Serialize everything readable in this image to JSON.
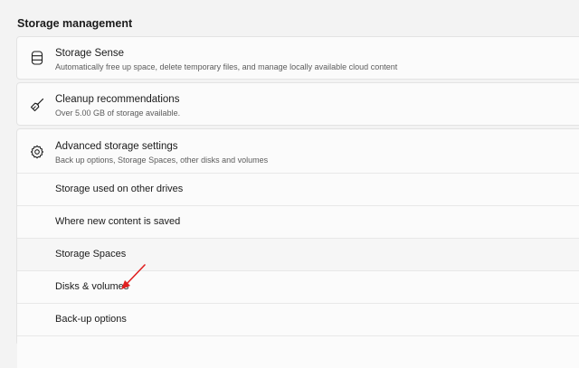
{
  "section": {
    "title": "Storage management"
  },
  "cards": {
    "storage_sense": {
      "title": "Storage Sense",
      "description": "Automatically free up space, delete temporary files, and manage locally available cloud content",
      "icon": "storage-drive-icon"
    },
    "cleanup": {
      "title": "Cleanup recommendations",
      "description": "Over 5.00 GB of storage available.",
      "icon": "broom-icon"
    },
    "advanced": {
      "title": "Advanced storage settings",
      "description": "Back up options, Storage Spaces, other disks and volumes",
      "icon": "gear-icon",
      "items": [
        {
          "label": "Storage used on other drives"
        },
        {
          "label": "Where new content is saved"
        },
        {
          "label": "Storage Spaces"
        },
        {
          "label": "Disks & volumes"
        },
        {
          "label": "Back-up options"
        }
      ]
    }
  },
  "annotation": {
    "arrow_color": "#e02020",
    "target": "Disks & volumes"
  }
}
